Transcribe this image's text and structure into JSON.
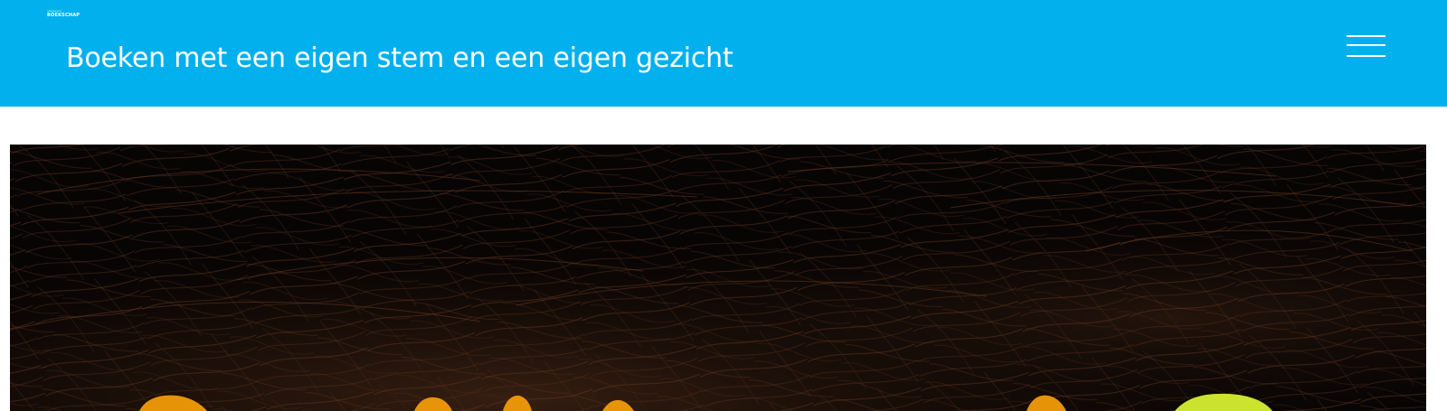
{
  "header": {
    "logo": {
      "top_text": "uitgeverij",
      "main_text": "BOEKSCHAP"
    },
    "tagline": "Boeken met een eigen stem en een eigen gezicht",
    "menu_icon": "hamburger-menu-icon"
  },
  "colors": {
    "header_background": "#03b0ee",
    "header_text": "#ffffff",
    "hero_background": "#070404",
    "hero_texture": "#5a3119",
    "title_orange": "#f29b08",
    "title_yellow": "#d6ef31"
  }
}
